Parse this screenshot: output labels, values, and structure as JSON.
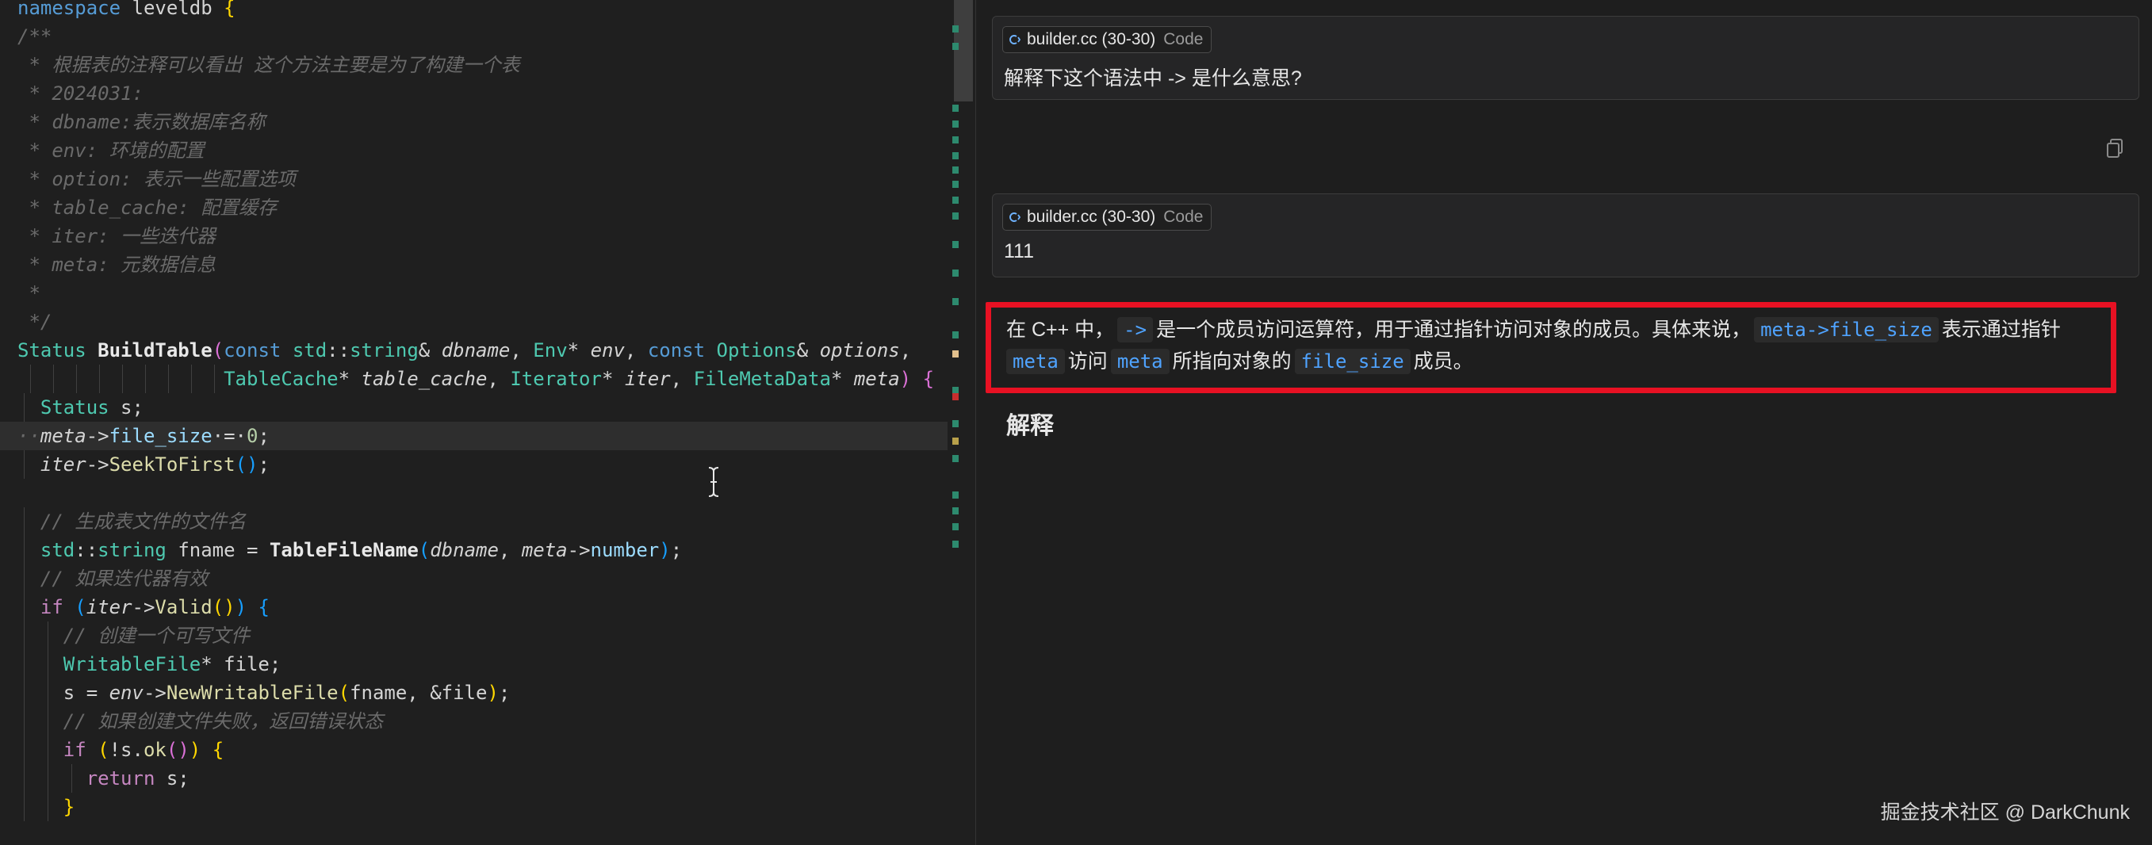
{
  "editor": {
    "lines": [
      [
        [
          "namespace",
          "kw"
        ],
        [
          " leveldb ",
          "pl"
        ],
        [
          "{",
          "brk1"
        ]
      ],
      [
        [
          "/**",
          "cmt"
        ]
      ],
      [
        [
          " * 根据表的注释可以看出 这个方法主要是为了构建一个表",
          "cmt"
        ]
      ],
      [
        [
          " * 2024031:",
          "cmt"
        ]
      ],
      [
        [
          " * dbname:表示数据库名称",
          "cmt"
        ]
      ],
      [
        [
          " * env: 环境的配置",
          "cmt"
        ]
      ],
      [
        [
          " * option: 表示一些配置选项",
          "cmt"
        ]
      ],
      [
        [
          " * table_cache: 配置缓存",
          "cmt"
        ]
      ],
      [
        [
          " * iter: 一些迭代器",
          "cmt"
        ]
      ],
      [
        [
          " * meta: 元数据信息",
          "cmt"
        ]
      ],
      [
        [
          " *",
          "cmt"
        ]
      ],
      [
        [
          " */",
          "cmt"
        ]
      ],
      [
        [
          "Status",
          "type"
        ],
        [
          " ",
          "pl"
        ],
        [
          "BuildTable",
          "fnb"
        ],
        [
          "(",
          "brk2"
        ],
        [
          "const",
          "kw"
        ],
        [
          " ",
          "pl"
        ],
        [
          "std",
          "type"
        ],
        [
          "::",
          "pl"
        ],
        [
          "string",
          "type"
        ],
        [
          "& ",
          "pl"
        ],
        [
          "dbname",
          "var"
        ],
        [
          ", ",
          "pl"
        ],
        [
          "Env",
          "type"
        ],
        [
          "* ",
          "pl"
        ],
        [
          "env",
          "var"
        ],
        [
          ", ",
          "pl"
        ],
        [
          "const",
          "kw"
        ],
        [
          " ",
          "pl"
        ],
        [
          "Options",
          "type"
        ],
        [
          "& ",
          "pl"
        ],
        [
          "options",
          "var"
        ],
        [
          ",",
          "pl"
        ]
      ],
      [
        [
          "                  ",
          "pl"
        ],
        [
          "TableCache",
          "type"
        ],
        [
          "* ",
          "pl"
        ],
        [
          "table_cache",
          "var"
        ],
        [
          ", ",
          "pl"
        ],
        [
          "Iterator",
          "type"
        ],
        [
          "* ",
          "pl"
        ],
        [
          "iter",
          "var"
        ],
        [
          ", ",
          "pl"
        ],
        [
          "FileMetaData",
          "type"
        ],
        [
          "* ",
          "pl"
        ],
        [
          "meta",
          "var"
        ],
        [
          ") ",
          "brk2"
        ],
        [
          "{",
          "brk2"
        ]
      ],
      [
        [
          "  ",
          "pl"
        ],
        [
          "Status",
          "type"
        ],
        [
          " s;",
          "pl"
        ]
      ],
      [
        [
          "··",
          "cmt"
        ],
        [
          "meta",
          "var"
        ],
        [
          "->",
          "pl"
        ],
        [
          "file_size",
          "mem"
        ],
        [
          "·=·",
          "pl"
        ],
        [
          "0",
          "num"
        ],
        [
          ";",
          "pl"
        ]
      ],
      [
        [
          "  ",
          "pl"
        ],
        [
          "iter",
          "var"
        ],
        [
          "->",
          "pl"
        ],
        [
          "SeekToFirst",
          "fn"
        ],
        [
          "()",
          "brk3"
        ],
        [
          ";",
          "pl"
        ]
      ],
      [
        [
          "",
          "pl"
        ]
      ],
      [
        [
          "  ",
          "pl"
        ],
        [
          "// 生成表文件的文件名",
          "cmt"
        ]
      ],
      [
        [
          "  ",
          "pl"
        ],
        [
          "std",
          "type"
        ],
        [
          "::",
          "pl"
        ],
        [
          "string",
          "type"
        ],
        [
          " fname = ",
          "pl"
        ],
        [
          "TableFileName",
          "fnb"
        ],
        [
          "(",
          "brk3"
        ],
        [
          "dbname",
          "var"
        ],
        [
          ", ",
          "pl"
        ],
        [
          "meta",
          "var"
        ],
        [
          "->",
          "pl"
        ],
        [
          "number",
          "mem"
        ],
        [
          ")",
          "brk3"
        ],
        [
          ";",
          "pl"
        ]
      ],
      [
        [
          "  ",
          "pl"
        ],
        [
          "// 如果迭代器有效",
          "cmt"
        ]
      ],
      [
        [
          "  ",
          "pl"
        ],
        [
          "if",
          "ctl"
        ],
        [
          " ",
          "pl"
        ],
        [
          "(",
          "brk3"
        ],
        [
          "iter",
          "var"
        ],
        [
          "->",
          "pl"
        ],
        [
          "Valid",
          "fn"
        ],
        [
          "()",
          "brk1"
        ],
        [
          ")",
          "brk3"
        ],
        [
          " ",
          "pl"
        ],
        [
          "{",
          "brk3"
        ]
      ],
      [
        [
          "    ",
          "pl"
        ],
        [
          "// 创建一个可写文件",
          "cmt"
        ]
      ],
      [
        [
          "    ",
          "pl"
        ],
        [
          "WritableFile",
          "type"
        ],
        [
          "* file;",
          "pl"
        ]
      ],
      [
        [
          "    ",
          "pl"
        ],
        [
          "s = ",
          "pl"
        ],
        [
          "env",
          "var"
        ],
        [
          "->",
          "pl"
        ],
        [
          "NewWritableFile",
          "fn"
        ],
        [
          "(",
          "brk1"
        ],
        [
          "fname, &file",
          "pl"
        ],
        [
          ")",
          "brk1"
        ],
        [
          ";",
          "pl"
        ]
      ],
      [
        [
          "    ",
          "pl"
        ],
        [
          "// 如果创建文件失败，返回错误状态",
          "cmt"
        ]
      ],
      [
        [
          "    ",
          "pl"
        ],
        [
          "if",
          "ctl"
        ],
        [
          " ",
          "pl"
        ],
        [
          "(",
          "brk1"
        ],
        [
          "!s.",
          "pl"
        ],
        [
          "ok",
          "fn"
        ],
        [
          "()",
          "brk2"
        ],
        [
          ")",
          "brk1"
        ],
        [
          " ",
          "pl"
        ],
        [
          "{",
          "brk1"
        ]
      ],
      [
        [
          "      ",
          "pl"
        ],
        [
          "return",
          "ctl"
        ],
        [
          " s;",
          "pl"
        ]
      ],
      [
        [
          "    ",
          "pl"
        ],
        [
          "}",
          "brk1"
        ]
      ],
      [
        [
          "",
          "pl"
        ]
      ]
    ]
  },
  "chat": {
    "message1": {
      "chip_file": "builder.cc (30-30)",
      "chip_kind": "Code",
      "text": "解释下这个语法中 -> 是什么意思?"
    },
    "message2": {
      "chip_file": "builder.cc (30-30)",
      "chip_kind": "Code",
      "text": "111"
    },
    "answer": {
      "p1_a": "在 C++ 中，",
      "code_arrow": "->",
      "p1_b": "是一个成员访问运算符，用于通过指针访问对象的成员。具体来说，",
      "code_expr": "meta->file_size",
      "p1_c": "表示通过指针",
      "code_meta1": "meta",
      "p1_d": "访问",
      "code_meta2": "meta",
      "p1_e": "所指向对象的",
      "code_field": "file_size",
      "p1_f": "成员。"
    },
    "heading": "解释"
  },
  "watermark": "掘金技术社区 @ DarkChunk",
  "colors": {
    "highlight_border": "#e81123",
    "inline_code": "#4fa3ff",
    "keyword": "#569cd6",
    "type": "#4ec9b0",
    "function": "#dcdcaa",
    "comment": "#6a6a6a"
  },
  "icons": {
    "chip": "code-reference-icon",
    "copy": "copy-icon",
    "cursor": "text-cursor-icon"
  }
}
